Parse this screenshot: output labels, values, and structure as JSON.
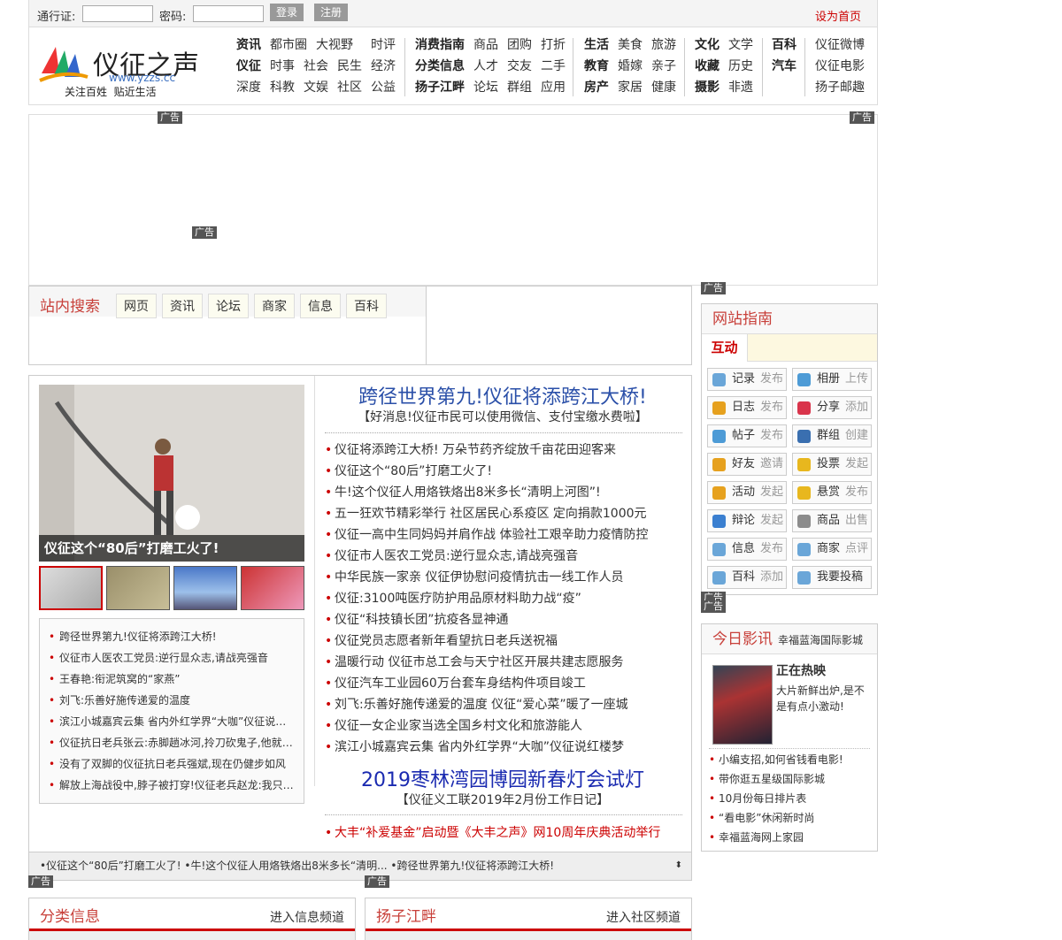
{
  "topbar": {
    "passport_label": "通行证:",
    "password_label": "密码:",
    "login": "登录",
    "register": "注册",
    "set_home": "设为首页"
  },
  "logo": {
    "name": "仪征之声",
    "domain": "www.yzzs.cc",
    "slogan": "关注百姓  贴近生活"
  },
  "nav": {
    "col1": [
      [
        "资讯",
        "都市圈",
        "大视野",
        "时评"
      ],
      [
        "仪征",
        "时事",
        "社会",
        "民生",
        "经济"
      ],
      [
        "深度",
        "科教",
        "文娱",
        "社区",
        "公益"
      ]
    ],
    "col2": [
      [
        "消费指南",
        "商品",
        "团购",
        "打折"
      ],
      [
        "分类信息",
        "人才",
        "交友",
        "二手"
      ],
      [
        "扬子江畔",
        "论坛",
        "群组",
        "应用"
      ]
    ],
    "col3": [
      [
        "生活",
        "美食",
        "旅游"
      ],
      [
        "教育",
        "婚嫁",
        "亲子"
      ],
      [
        "房产",
        "家居",
        "健康"
      ]
    ],
    "col4": [
      [
        "文化",
        "文学"
      ],
      [
        "收藏",
        "历史"
      ],
      [
        "摄影",
        "非遗"
      ]
    ],
    "col5": [
      [
        "百科"
      ],
      [
        "汽车"
      ],
      [
        ""
      ]
    ],
    "col6": [
      [
        "仪征微博"
      ],
      [
        "仪征电影"
      ],
      [
        "扬子邮趣"
      ]
    ]
  },
  "ad_label": "广告",
  "search": {
    "title": "站内搜索",
    "tabs": [
      "网页",
      "资讯",
      "论坛",
      "商家",
      "信息",
      "百科"
    ]
  },
  "slideshow": {
    "caption": "仪征这个“80后”打磨工火了!"
  },
  "left_news": [
    "跨径世界第九!仪征将添跨江大桥!",
    "仪征市人医农工党员:逆行显众志,请战亮强音",
    "王春艳:衔泥筑窝的“家燕”",
    "刘飞:乐善好施传递爱的温度",
    "滨江小城嘉宾云集 省内外红学界“大咖”仪征说红楼梦",
    "仪征抗日老兵张云:赤脚趟冰河,拎刀砍鬼子,他就是当年的一员猛将",
    "没有了双脚的仪征抗日老兵强斌,现在仍健步如风",
    "解放上海战役中,脖子被打穿!仪征老兵赵龙:我只是个幸存者"
  ],
  "headline1": {
    "title": "跨径世界第九!仪征将添跨江大桥!",
    "sub": "【好消息!仪征市民可以使用微信、支付宝缴水费啦】"
  },
  "news": [
    "仪征将添跨江大桥!  万朵节药齐绽放千亩花田迎客来",
    "仪征这个“80后”打磨工火了!",
    "牛!这个仪征人用烙铁烙出8米多长“清明上河图”!",
    "五一狂欢节精彩举行  社区居民心系疫区 定向捐款1000元",
    "仪征一高中生同妈妈并肩作战 体验社工艰辛助力疫情防控",
    "仪征市人医农工党员:逆行显众志,请战亮强音",
    "中华民族一家亲 仪征伊协慰问疫情抗击一线工作人员",
    "仪征:3100吨医疗防护用品原材料助力战“疫”",
    "仪征“科技镇长团”抗疫各显神通",
    "仪征党员志愿者新年看望抗日老兵送祝福",
    "温暖行动 仪征市总工会与天宁社区开展共建志愿服务",
    "仪征汽车工业园60万台套车身结构件项目竣工",
    "刘飞:乐善好施传递爱的温度 仪征“爱心菜”暖了一座城",
    "仪征一女企业家当选全国乡村文化和旅游能人",
    "滨江小城嘉宾云集 省内外红学界“大咖”仪征说红楼梦"
  ],
  "headline2": {
    "title": "2019枣林湾园博园新春灯会试灯",
    "sub": "【仪征义工联2019年2月份工作日记】"
  },
  "bottom_news": "大丰“补爱基金”启动暨《大丰之声》网10周年庆典活动举行",
  "ticker": "•仪征这个“80后”打磨工火了!  •牛!这个仪征人用烙铁烙出8米多长“清明...  •跨径世界第九!仪征将添跨江大桥!",
  "guide": {
    "title": "网站指南",
    "tab": "互动",
    "items": [
      [
        "记录",
        "发布"
      ],
      [
        "相册",
        "上传"
      ],
      [
        "日志",
        "发布"
      ],
      [
        "分享",
        "添加"
      ],
      [
        "帖子",
        "发布"
      ],
      [
        "群组",
        "创建"
      ],
      [
        "好友",
        "邀请"
      ],
      [
        "投票",
        "发起"
      ],
      [
        "活动",
        "发起"
      ],
      [
        "悬赏",
        "发布"
      ],
      [
        "辩论",
        "发起"
      ],
      [
        "商品",
        "出售"
      ],
      [
        "信息",
        "发布"
      ],
      [
        "商家",
        "点评"
      ],
      [
        "百科",
        "添加"
      ],
      [
        "我要投稿",
        ""
      ]
    ],
    "icon_colors": [
      "#6aa6d8",
      "#4d9bd6",
      "#e6a11e",
      "#d9344b",
      "#4d9bd6",
      "#3a6fb0",
      "#e6a11e",
      "#e8b71e",
      "#e6a11e",
      "#e8b71e",
      "#3a7fd0",
      "#8c8c8c",
      "#6aa6d8",
      "#6aa6d8",
      "#6aa6d8",
      "#6aa6d8"
    ]
  },
  "movie": {
    "title": "今日影讯",
    "cinema": "幸福蓝海国际影城",
    "now": "正在热映",
    "desc": "大片新鲜出炉,是不是有点小激动!",
    "list": [
      "小编支招,如何省钱看电影!",
      "带你逛五星级国际影城",
      "10月份每日排片表",
      "“看电影”休闲新时尚",
      "幸福蓝海网上家园"
    ]
  },
  "panels": [
    {
      "title": "分类信息",
      "link": "进入信息频道"
    },
    {
      "title": "扬子江畔",
      "link": "进入社区频道"
    }
  ]
}
